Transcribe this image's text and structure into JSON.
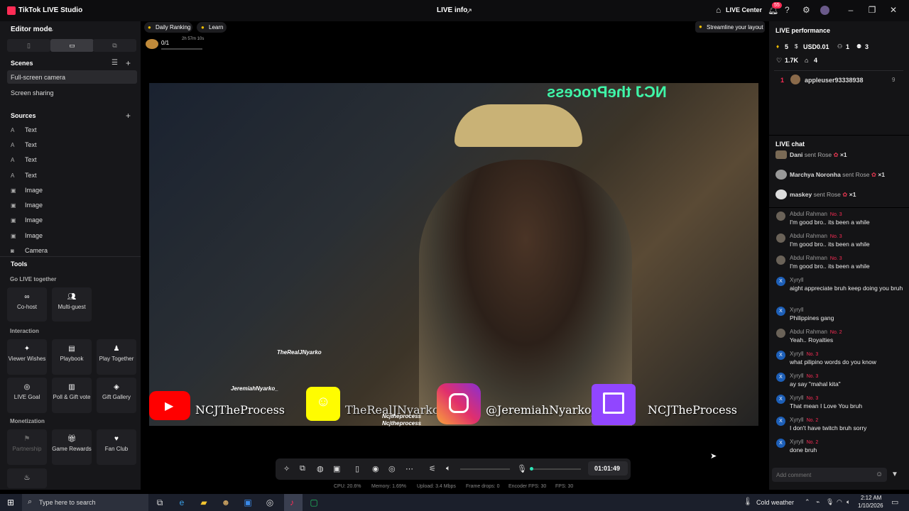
{
  "app": {
    "title": "TikTok LIVE Studio",
    "live_info": "LIVE info",
    "live_center": "LIVE Center",
    "notif_count": "55"
  },
  "left": {
    "editor_mode": "Editor mode",
    "scenes_label": "Scenes",
    "scenes": [
      "Full-screen camera",
      "Screen sharing"
    ],
    "sources_label": "Sources",
    "sources": [
      "Text",
      "Text",
      "Text",
      "Text",
      "Image",
      "Image",
      "Image",
      "Image",
      "Camera"
    ],
    "tools_label": "Tools",
    "go_live_label": "Go LIVE together",
    "go_live_tools": [
      "Co-host",
      "Multi-guest"
    ],
    "interaction_label": "Interaction",
    "interaction_tools": [
      "Viewer Wishes",
      "Playbook",
      "Play Together",
      "LIVE Goal",
      "Poll & Gift vote",
      "Gift Gallery"
    ],
    "monetization_label": "Monetization",
    "monetization_tools": [
      "Partnership",
      "Game Rewards",
      "Fan Club"
    ]
  },
  "top": {
    "daily_ranking": "Daily Ranking",
    "learn": "Learn",
    "goal_progress": "0/1",
    "goal_timer": "2h 57m 10s",
    "streamline": "Streamline your layout"
  },
  "video": {
    "socials": [
      "NCJTheProcess",
      "TheRealJNyarko",
      "@JeremiahNyarko_",
      "NCJTheProcess"
    ],
    "handles": [
      "TheRealJNyarko",
      "JeremiahNyarko_",
      "Ncjtheprocess",
      "Ncjtheprocess"
    ]
  },
  "controls": {
    "timer": "01:01:49"
  },
  "stats": [
    "CPU: 20.6%",
    "Memory: 1.69%",
    "Upload: 3.4 Mbps",
    "Frame drops: 0",
    "Encoder FPS: 30",
    "FPS: 30"
  ],
  "right": {
    "perf_label": "LIVE performance",
    "metrics": [
      "5",
      "USD0.01",
      "1",
      "3",
      "1.7K",
      "4"
    ],
    "top_rank": "1",
    "top_user": "appleuser93338938",
    "top_score": "9",
    "chat_label": "LIVE chat",
    "gifts": [
      {
        "user": "Dani",
        "text": "sent Rose",
        "count": "×1"
      },
      {
        "user": "Marchya Noronha",
        "text": "sent Rose",
        "count": "×1"
      },
      {
        "user": "maskey",
        "text": "sent Rose",
        "count": "×1"
      }
    ],
    "messages": [
      {
        "name": "Abdul Rahman",
        "badge": "No. 3",
        "msg": "I'm good bro.. its been a while"
      },
      {
        "name": "Abdul Rahman",
        "badge": "No. 3",
        "msg": "I'm good bro.. its been a while"
      },
      {
        "name": "Abdul Rahman",
        "badge": "No. 3",
        "msg": "I'm good bro.. its been a while"
      },
      {
        "name": "Xyryll",
        "badge": "",
        "msg": "aight appreciate bruh keep doing you bruh"
      },
      {
        "name": "Xyryll",
        "badge": "",
        "msg": "Philippines gang"
      },
      {
        "name": "Abdul Rahman",
        "badge": "No. 2",
        "msg": "Yeah.. Royalties"
      },
      {
        "name": "Xyryll",
        "badge": "No. 3",
        "msg": "what pilipino words do you know"
      },
      {
        "name": "Xyryll",
        "badge": "No. 3",
        "msg": "ay say \"mahal kita\""
      },
      {
        "name": "Xyryll",
        "badge": "No. 3",
        "msg": "That mean I Love You bruh"
      },
      {
        "name": "Xyryll",
        "badge": "No. 2",
        "msg": "I don't have twitch bruh sorry"
      },
      {
        "name": "Xyryll",
        "badge": "No. 2",
        "msg": "done bruh"
      }
    ],
    "comment_placeholder": "Add comment"
  },
  "taskbar": {
    "search_placeholder": "Type here to search",
    "weather": "Cold weather",
    "time": "2:12 AM",
    "date": "1/10/2026"
  }
}
